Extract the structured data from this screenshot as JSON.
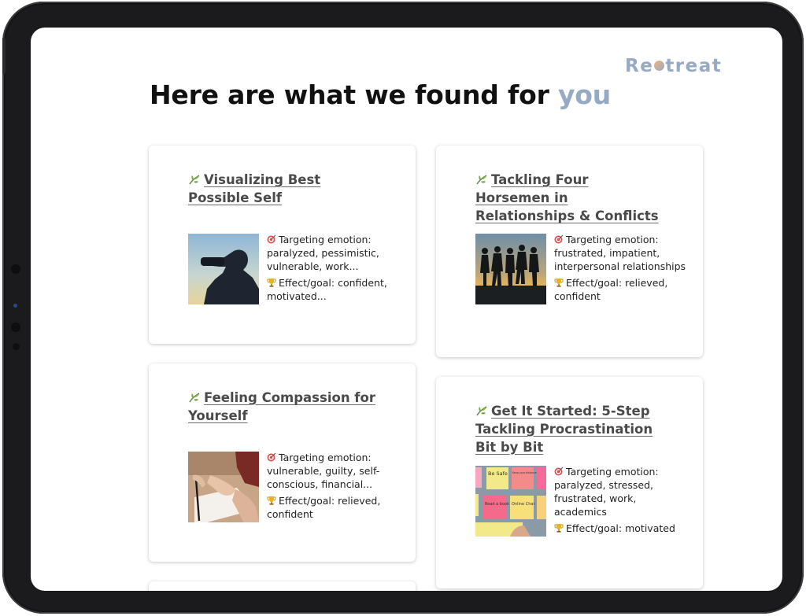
{
  "app": {
    "logo_text_a": "Re",
    "logo_text_b": "treat",
    "headline_main": "Here are what we found for ",
    "headline_accent": "you"
  },
  "colors": {
    "accent": "#97aac4",
    "bezel": "#1b1b1d",
    "card_bg": "#ffffff",
    "text": "#222222"
  },
  "cards": [
    {
      "title": "Visualizing Best Possible Self",
      "emotion_label": "Targeting emotion:",
      "emotion": "paralyzed, pessimistic, vulnerable, work...",
      "goal_label": "Effect/goal:",
      "goal": "confident, motivated...",
      "image_icon": "binoculars-photo"
    },
    {
      "title": "Tackling Four Horsemen in Relationships & Conflicts",
      "emotion_label": "Targeting emotion:",
      "emotion": "frustrated, impatient, interpersonal relationships",
      "goal_label": "Effect/goal:",
      "goal": "relieved, confident",
      "image_icon": "group-silhouette-photo"
    },
    {
      "title": "Feeling Compassion for Yourself",
      "emotion_label": "Targeting emotion:",
      "emotion": "vulnerable, guilty, self-conscious, financial...",
      "goal_label": "Effect/goal:",
      "goal": "relieved, confident",
      "image_icon": "writing-hand-photo"
    },
    {
      "title": "Get It Started: 5-Step Tackling Procrastination Bit by Bit",
      "emotion_label": "Targeting emotion:",
      "emotion": "paralyzed, stressed, frustrated, work, academics",
      "goal_label": "Effect/goal:",
      "goal": "motivated",
      "image_icon": "sticky-notes-photo",
      "sticky_notes": [
        "Be Safe",
        "Keep your distance",
        "Read a book",
        "Online Chat"
      ]
    }
  ],
  "icons": {
    "title_icon": "leaf-icon",
    "emotion_icon": "target-icon",
    "goal_icon": "trophy-icon"
  }
}
